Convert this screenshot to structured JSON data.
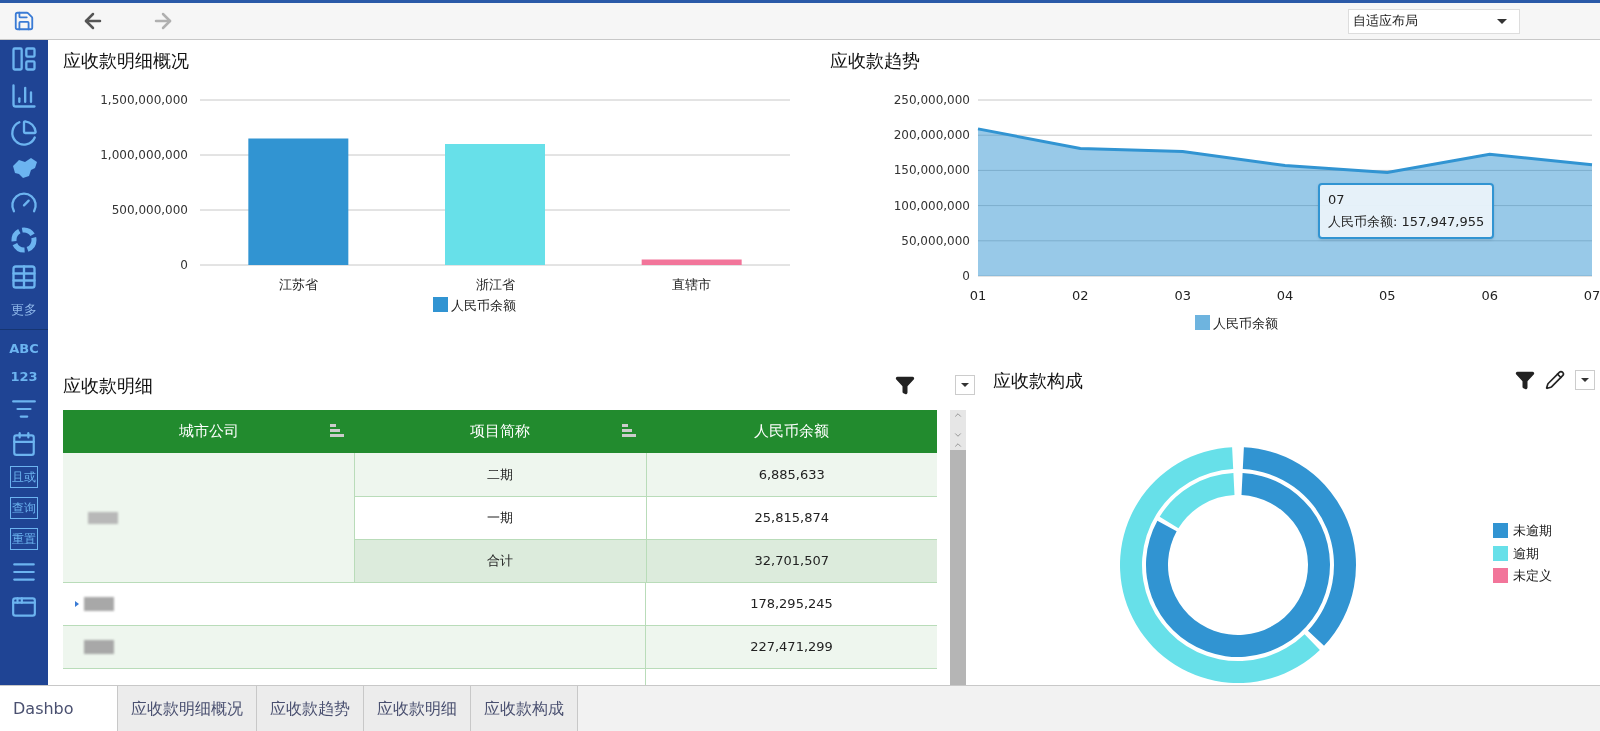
{
  "toolbar": {
    "nav": [
      {
        "kind": "back",
        "disabled": false
      },
      {
        "kind": "forward",
        "disabled": true
      }
    ],
    "layout_select": "自适应布局"
  },
  "sidebar": {
    "more": "更多",
    "text_buttons": [
      "ABC",
      "123"
    ],
    "boxed_buttons": [
      "且或",
      "查询",
      "重置"
    ]
  },
  "overview": {
    "title": "应收款明细概况",
    "bars": [
      {
        "color": "#3194d2"
      },
      {
        "color": "#67e0e9"
      },
      {
        "color": "#f2759a"
      }
    ],
    "chart_data": {
      "type": "bar",
      "grid": true,
      "categories": [
        "江苏省",
        "浙江省",
        "直辖市"
      ],
      "series": [
        {
          "name": "人民币余额",
          "values": [
            1150000000,
            1100000000,
            50000000
          ]
        }
      ],
      "ylim": [
        0,
        1500000000
      ],
      "yticks": [
        {
          "value": 0,
          "label": "0"
        },
        {
          "value": 500000000,
          "label": "500,000,000"
        },
        {
          "value": 1000000000,
          "label": "1,000,000,000"
        },
        {
          "value": 1500000000,
          "label": "1,500,000,000"
        }
      ]
    }
  },
  "trend": {
    "title": "应收款趋势",
    "tooltip": {
      "title": "07",
      "text": "人民币余额: 157,947,955"
    },
    "chart_data": {
      "type": "area",
      "grid": true,
      "x": [
        "01",
        "02",
        "03",
        "04",
        "05",
        "06",
        "07"
      ],
      "series": [
        {
          "name": "人民币余额",
          "color": "#3194d2",
          "values": [
            209000000,
            181000000,
            177000000,
            157000000,
            147000000,
            173000000,
            158000000
          ]
        }
      ],
      "ylim": [
        0,
        250000000
      ],
      "yticks": [
        {
          "value": 0,
          "label": "0"
        },
        {
          "value": 50000000,
          "label": "50,000,000"
        },
        {
          "value": 100000000,
          "label": "100,000,000"
        },
        {
          "value": 150000000,
          "label": "150,000,000"
        },
        {
          "value": 200000000,
          "label": "200,000,000"
        },
        {
          "value": 250000000,
          "label": "250,000,000"
        }
      ]
    }
  },
  "detail": {
    "title": "应收款明细",
    "columns": [
      "城市公司",
      "项目简称",
      "人民币余额"
    ],
    "group": {
      "rows": [
        {
          "project": "二期",
          "amount": "6,885,633",
          "kind": "item"
        },
        {
          "project": "一期",
          "amount": "25,815,874",
          "kind": "item"
        },
        {
          "project": "合计",
          "amount": "32,701,507",
          "kind": "total"
        }
      ]
    },
    "rows": [
      {
        "amount": "178,295,245",
        "expandable": true
      },
      {
        "amount": "227,471,299",
        "expandable": false
      }
    ]
  },
  "composition": {
    "title": "应收款构成",
    "legend": [
      {
        "label": "未逾期",
        "color": "#3194d2"
      },
      {
        "label": "逾期",
        "color": "#67e0e9"
      },
      {
        "label": "未定义",
        "color": "#f2759a"
      }
    ]
  },
  "tabs": [
    {
      "label": "Dashbo",
      "selected": true
    },
    {
      "label": "应收款明细概况",
      "selected": false
    },
    {
      "label": "应收款趋势",
      "selected": false
    },
    {
      "label": "应收款明细",
      "selected": false
    },
    {
      "label": "应收款构成",
      "selected": false
    }
  ]
}
